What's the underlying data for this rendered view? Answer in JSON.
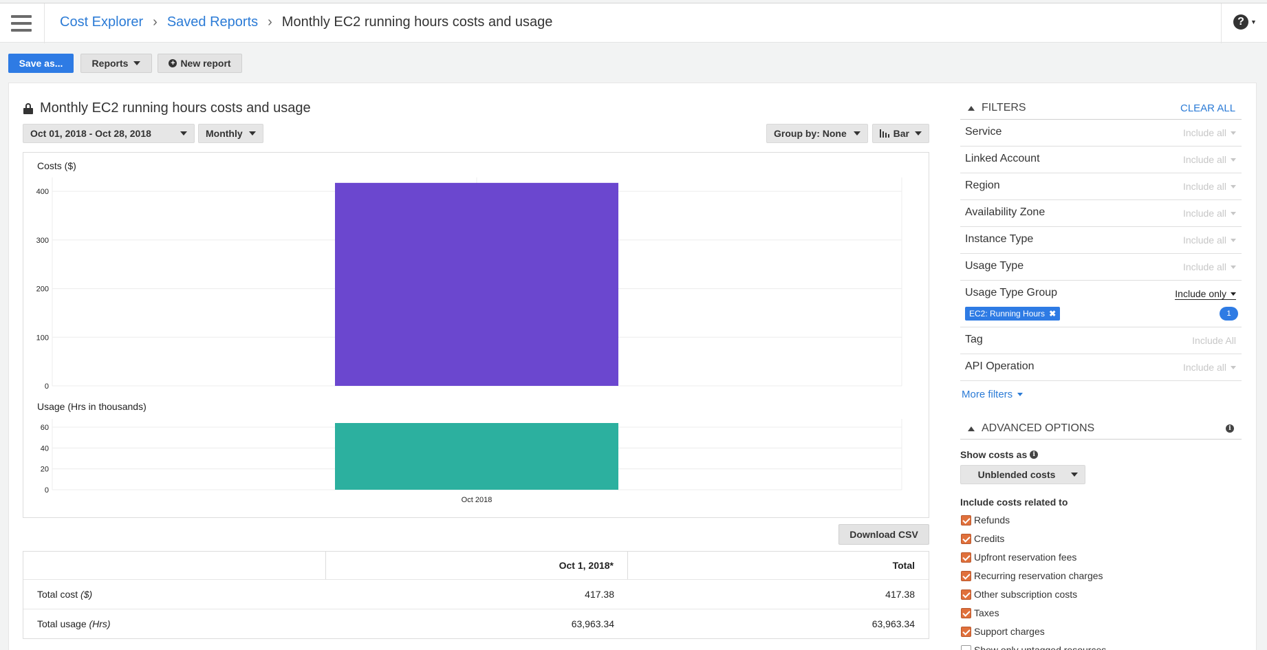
{
  "header": {
    "breadcrumb": [
      "Cost Explorer",
      "Saved Reports",
      "Monthly EC2 running hours costs and usage"
    ],
    "help_icon": "help-icon"
  },
  "toolbar": {
    "save_as": "Save as...",
    "reports": "Reports",
    "new_report": "New report"
  },
  "report": {
    "title": "Monthly EC2 running hours costs and usage",
    "date_range": "Oct 01, 2018 - Oct 28, 2018",
    "granularity": "Monthly",
    "group_by": "Group by: None",
    "chart_style": "Bar"
  },
  "chart_data": [
    {
      "type": "bar",
      "title": "Costs ($)",
      "categories": [
        "Oct 2018"
      ],
      "values": [
        417.38
      ],
      "ylim": [
        0,
        420
      ],
      "yticks": [
        "0",
        "100",
        "200",
        "300",
        "400"
      ],
      "color": "#6b47cf"
    },
    {
      "type": "bar",
      "title": "Usage (Hrs in thousands)",
      "categories": [
        "Oct 2018"
      ],
      "values": [
        63.96334
      ],
      "ylim": [
        0,
        63.96
      ],
      "yticks": [
        "0",
        "20",
        "40",
        "60"
      ],
      "xlabel_tick": "Oct 2018",
      "color": "#2cb09f"
    }
  ],
  "table": {
    "download": "Download CSV",
    "headers": [
      "",
      "Oct 1, 2018*",
      "Total"
    ],
    "rows": [
      {
        "label": "Total cost",
        "unit": "($)",
        "period": "417.38",
        "total": "417.38"
      },
      {
        "label": "Total usage",
        "unit": "(Hrs)",
        "period": "63,963.34",
        "total": "63,963.34"
      }
    ]
  },
  "filters": {
    "heading": "FILTERS",
    "clear_all": "CLEAR ALL",
    "items": [
      {
        "name": "Service",
        "value": "Include all"
      },
      {
        "name": "Linked Account",
        "value": "Include all"
      },
      {
        "name": "Region",
        "value": "Include all"
      },
      {
        "name": "Availability Zone",
        "value": "Include all"
      },
      {
        "name": "Instance Type",
        "value": "Include all"
      },
      {
        "name": "Usage Type",
        "value": "Include all"
      },
      {
        "name": "Usage Type Group",
        "value": "Include only"
      },
      {
        "name": "Tag",
        "value": "Include All"
      },
      {
        "name": "API Operation",
        "value": "Include all"
      }
    ],
    "chip": "EC2: Running Hours",
    "chip_count": "1",
    "more": "More filters"
  },
  "advanced": {
    "heading": "ADVANCED OPTIONS",
    "show_costs_as": "Show costs as",
    "cost_type": "Unblended costs",
    "include_related": "Include costs related to",
    "checkboxes": [
      {
        "label": "Refunds",
        "checked": true
      },
      {
        "label": "Credits",
        "checked": true
      },
      {
        "label": "Upfront reservation fees",
        "checked": true
      },
      {
        "label": "Recurring reservation charges",
        "checked": true
      },
      {
        "label": "Other subscription costs",
        "checked": true
      },
      {
        "label": "Taxes",
        "checked": true
      },
      {
        "label": "Support charges",
        "checked": true
      },
      {
        "label": "Show only untagged resources",
        "checked": false
      }
    ]
  },
  "colors": {
    "accent": "#2e7be4",
    "cost_bar": "#6b47cf",
    "usage_bar": "#2cb09f",
    "checkbox": "#e0703b"
  }
}
